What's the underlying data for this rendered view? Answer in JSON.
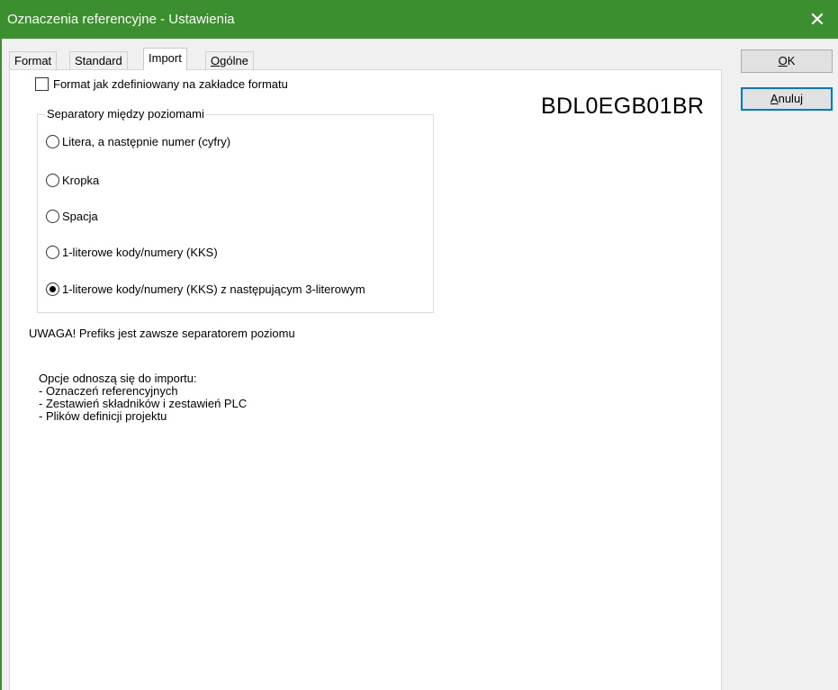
{
  "window": {
    "title": "Oznaczenia referencyjne - Ustawienia",
    "close_glyph": "✕",
    "accent_color": "#3b8f2e"
  },
  "tabs": [
    {
      "label": "Format",
      "active": false
    },
    {
      "label": "Standard",
      "active": false
    },
    {
      "label": "Import",
      "active": true
    },
    {
      "label": "Ogólne",
      "active": false
    }
  ],
  "import_tab": {
    "format_checkbox": {
      "label": "Format jak zdefiniowany na zakładce formatu",
      "checked": false
    },
    "separator_group": {
      "legend": "Separatory między poziomami",
      "options": [
        {
          "label": "Litera, a następnie numer (cyfry)",
          "selected": false
        },
        {
          "label": "Kropka",
          "selected": false
        },
        {
          "label": "Spacja",
          "selected": false
        },
        {
          "label": "1-literowe kody/numery (KKS)",
          "selected": false
        },
        {
          "label": "1-literowe kody/numery (KKS) z następującym 3-literowym",
          "selected": true
        }
      ]
    },
    "preview_code": "BDL0EGB01BR",
    "note": "UWAGA! Prefiks jest zawsze separatorem poziomu",
    "options_heading": "Opcje odnoszą się do importu:",
    "options_list": [
      "- Oznaczeń referencyjnych",
      "- Zestawień składników i zestawień PLC",
      "- Plików definicji projektu"
    ]
  },
  "buttons": {
    "ok": "OK",
    "cancel": "Anuluj"
  }
}
